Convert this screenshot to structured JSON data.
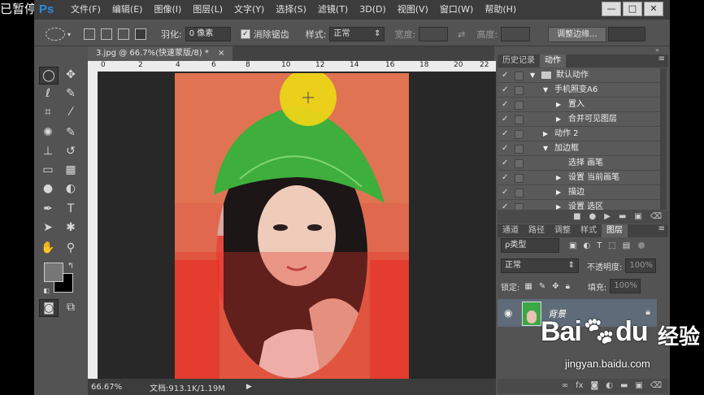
{
  "overlay": {
    "paused_label": "已暂停"
  },
  "app": {
    "logo": "Ps",
    "menu": [
      "文件(F)",
      "编辑(E)",
      "图像(I)",
      "图层(L)",
      "文字(Y)",
      "选择(S)",
      "滤镜(T)",
      "3D(D)",
      "视图(V)",
      "窗口(W)",
      "帮助(H)"
    ],
    "window_controls": {
      "minimize": "—",
      "maximize": "□",
      "close": "✕"
    }
  },
  "options": {
    "feather_label": "羽化:",
    "feather_value": "0 像素",
    "antialias_label": "消除锯齿",
    "style_label": "样式:",
    "style_value": "正常",
    "width_label": "宽度:",
    "height_label": "高度:",
    "refine_button": "调整边缘..."
  },
  "document": {
    "tab_title": "3.jpg @ 66.7%(快速蒙版/8) *",
    "tab_close": "×",
    "ruler_ticks": [
      "0",
      "2",
      "4",
      "6",
      "8",
      "10",
      "12",
      "14",
      "16",
      "18",
      "20",
      "22"
    ],
    "zoom": "66.67%",
    "doc_info": "文档:913.1K/1.19M"
  },
  "panels": {
    "top_tabs": [
      "历史记录",
      "动作"
    ],
    "actions": [
      {
        "indent": 0,
        "label": "默认动作",
        "folder": true,
        "expanded": true
      },
      {
        "indent": 1,
        "label": "手机照变A6",
        "expanded": true
      },
      {
        "indent": 2,
        "label": "置入"
      },
      {
        "indent": 2,
        "label": "合并可见图层"
      },
      {
        "indent": 1,
        "label": "动作 2"
      },
      {
        "indent": 1,
        "label": "加边框",
        "expanded": true
      },
      {
        "indent": 2,
        "label": "选择 画笔",
        "leaf": true
      },
      {
        "indent": 2,
        "label": "设置 当前画笔"
      },
      {
        "indent": 2,
        "label": "描边"
      },
      {
        "indent": 2,
        "label": "设置 选区"
      }
    ],
    "layer_tabs": [
      "通道",
      "路径",
      "调整",
      "样式",
      "图层"
    ],
    "kind_filter": "ρ类型",
    "blend_mode": "正常",
    "opacity_label": "不透明度:",
    "opacity_value": "100%",
    "lock_label": "锁定:",
    "fill_label": "填充:",
    "fill_value": "100%",
    "layer_name": "背景"
  },
  "watermark": {
    "brand": "Bai",
    "brand2": "du",
    "cn": "经验",
    "url": "jingyan.baidu.com"
  }
}
